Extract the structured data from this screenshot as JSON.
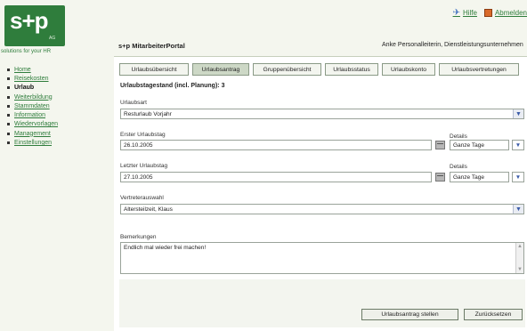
{
  "header": {
    "logo_text": "s+p",
    "logo_ag": "AG",
    "tagline": "solutions for your HR",
    "portal_title": "s+p MitarbeiterPortal",
    "user_info": "Anke Personalleiterin, Dienstleistungsunternehmen",
    "links": {
      "help": "Hilfe",
      "logout": "Abmelden"
    }
  },
  "sidebar": {
    "items": [
      {
        "label": "Home"
      },
      {
        "label": "Reisekosten"
      },
      {
        "label": "Urlaub"
      },
      {
        "label": "Weiterbildung"
      },
      {
        "label": "Stammdaten"
      },
      {
        "label": "Information"
      },
      {
        "label": "Wiedervorlagen"
      },
      {
        "label": "Management"
      },
      {
        "label": "Einstellungen"
      }
    ]
  },
  "tabs": [
    {
      "label": "Urlaubsübersicht"
    },
    {
      "label": "Urlaubsantrag"
    },
    {
      "label": "Gruppenübersicht"
    },
    {
      "label": "Urlaubsstatus"
    },
    {
      "label": "Urlaubskonto"
    },
    {
      "label": "Urlaubsvertretungen"
    }
  ],
  "form": {
    "balance_label": "Urlaubstagestand (incl. Planung): 3",
    "urlaubsart": {
      "label": "Urlaubsart",
      "value": "Resturlaub Vorjahr"
    },
    "erster": {
      "label": "Erster Urlaubstag",
      "value": "26.10.2005",
      "details_label": "Details",
      "details_value": "Ganze Tage"
    },
    "letzter": {
      "label": "Letzter Urlaubstag",
      "value": "27.10.2005",
      "details_label": "Details",
      "details_value": "Ganze Tage"
    },
    "vertreter": {
      "label": "Vertreterauswahl",
      "value": "Altersteilzeit, Klaus"
    },
    "bemerkungen": {
      "label": "Bemerkungen",
      "value": "Endlich mal wieder frei machen!"
    },
    "submit_label": "Urlaubsantrag stellen",
    "reset_label": "Zurücksetzen"
  }
}
